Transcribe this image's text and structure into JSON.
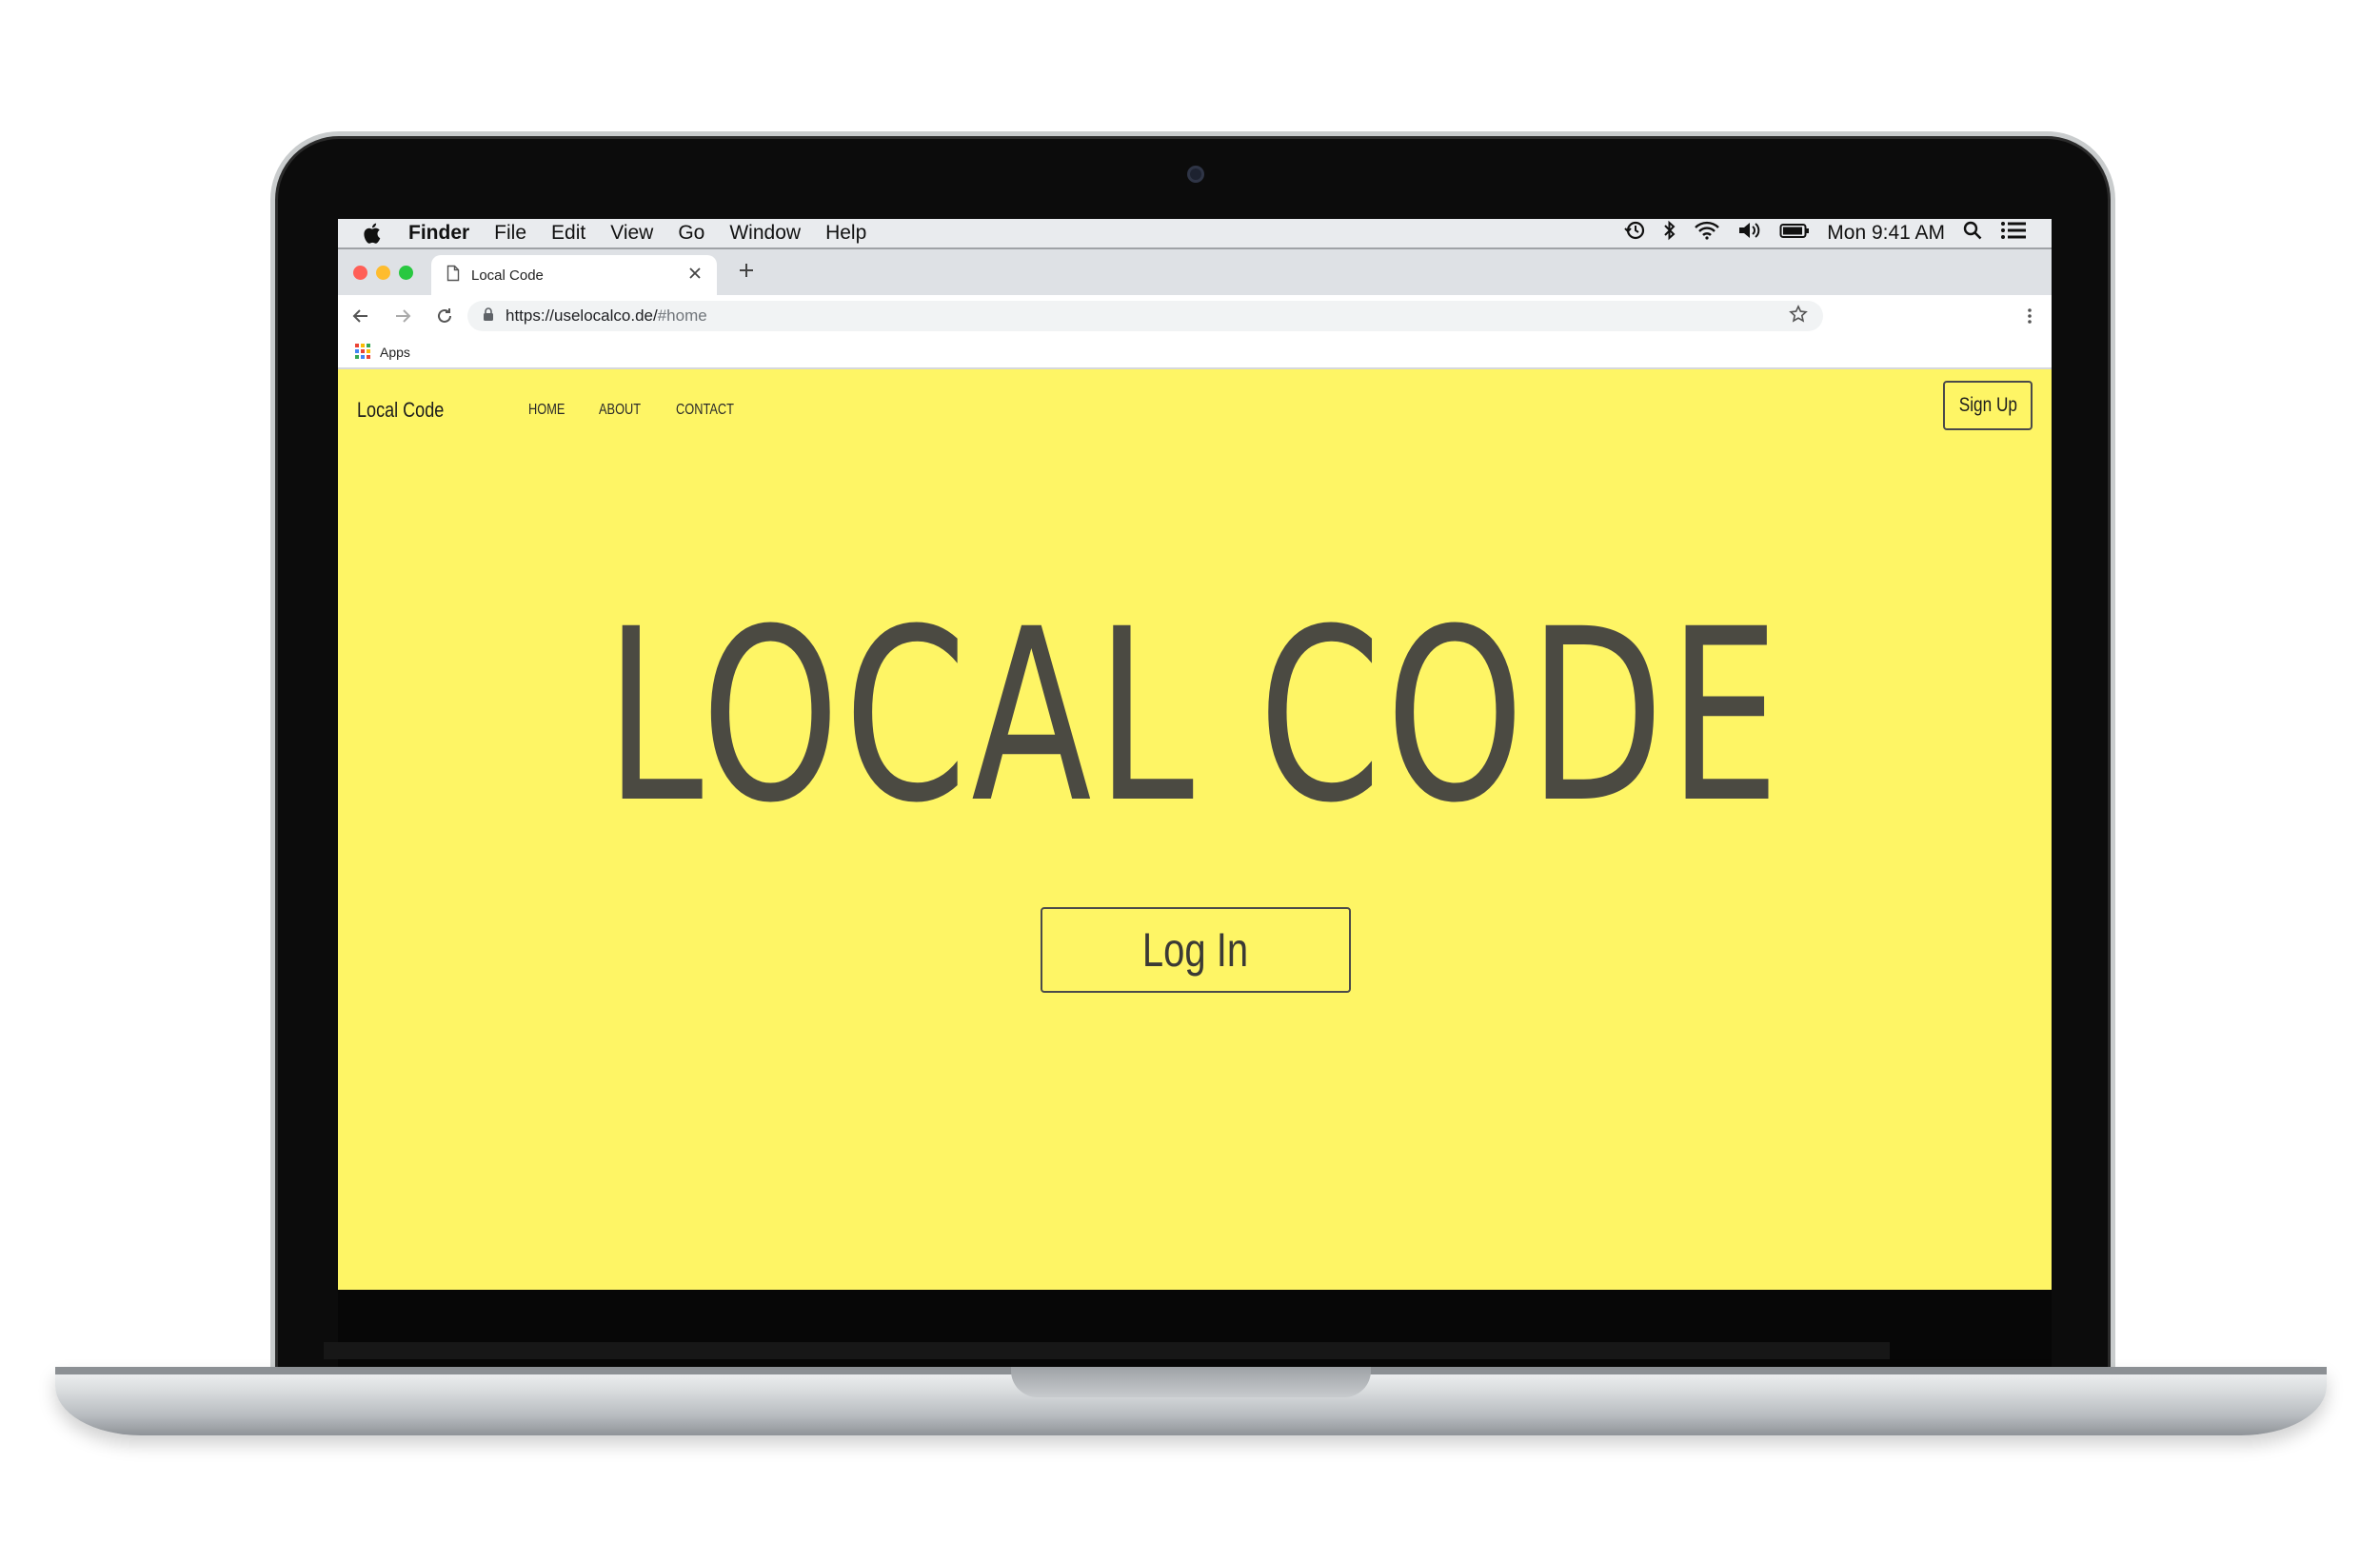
{
  "menubar": {
    "app_name": "Finder",
    "menus": [
      "File",
      "Edit",
      "View",
      "Go",
      "Window",
      "Help"
    ],
    "clock": "Mon 9:41 AM",
    "icons": [
      "apple-icon",
      "time-machine-icon",
      "bluetooth-icon",
      "wifi-icon",
      "volume-icon",
      "battery-icon",
      "spotlight-search-icon",
      "notification-center-icon"
    ]
  },
  "browser": {
    "traffic_lights": {
      "close": "#ff5f57",
      "minimize": "#febc2e",
      "maximize": "#28c840"
    },
    "tab": {
      "title": "Local Code",
      "icon": "document-icon"
    },
    "url": {
      "host": "https://uselocalco.de/",
      "path": "#home"
    },
    "bookmarks": {
      "apps_label": "Apps"
    }
  },
  "page": {
    "brand": "Local Code",
    "nav": [
      "HOME",
      "ABOUT",
      "CONTACT"
    ],
    "signup_label": "Sign Up",
    "hero_title": "LOCAL CODE",
    "login_label": "Log In",
    "background_color": "#fef565",
    "text_color": "#4b4a42"
  }
}
